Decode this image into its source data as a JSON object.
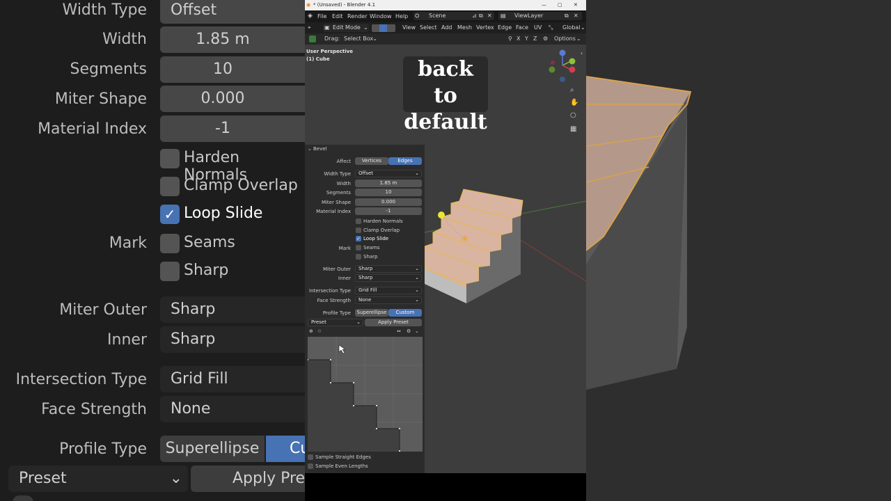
{
  "background_left": {
    "rows": [
      {
        "label": "Width Type",
        "value": "Offset"
      },
      {
        "label": "Width",
        "value": "1.85 m"
      },
      {
        "label": "Segments",
        "value": "10"
      },
      {
        "label": "Miter Shape",
        "value": "0.000"
      },
      {
        "label": "Material Index",
        "value": "-1"
      }
    ],
    "checks": [
      "Harden Normals",
      "Clamp Overlap",
      "Loop Slide"
    ],
    "mark_label": "Mark",
    "mark_checks": [
      "Seams",
      "Sharp"
    ],
    "rows2": [
      {
        "label": "Miter Outer",
        "value": "Sharp"
      },
      {
        "label": "Inner",
        "value": "Sharp"
      },
      {
        "label": "Intersection Type",
        "value": "Grid Fill"
      },
      {
        "label": "Face Strength",
        "value": "None"
      }
    ],
    "profile_label": "Profile Type",
    "profile_options": [
      "Superellipse",
      "Cu"
    ],
    "preset": "Preset",
    "apply_preset": "Apply Pres"
  },
  "window": {
    "title": "* (Unsaved) - Blender 4.1",
    "menus": [
      "File",
      "Edit",
      "Render",
      "Window",
      "Help"
    ],
    "scene": "Scene",
    "view_layer": "ViewLayer",
    "mode": "Edit Mode",
    "header_menus": [
      "View",
      "Select",
      "Add",
      "Mesh",
      "Vertex",
      "Edge",
      "Face",
      "UV"
    ],
    "orientation": "Global",
    "drag_label": "Drag:",
    "drag_value": "Select Box",
    "xyz": [
      "X",
      "Y",
      "Z"
    ],
    "options": "Options"
  },
  "viewport": {
    "perspective": "User Perspective",
    "object": "(1) Cube",
    "caption_line1": "back to",
    "caption_line2": "default"
  },
  "bevel_panel": {
    "title": "Bevel",
    "affect_label": "Affect",
    "affect_options": [
      "Vertices",
      "Edges"
    ],
    "width_type_label": "Width Type",
    "width_type": "Offset",
    "width_label": "Width",
    "width": "1.85 m",
    "segments_label": "Segments",
    "segments": "10",
    "miter_shape_label": "Miter Shape",
    "miter_shape": "0.000",
    "material_index_label": "Material Index",
    "material_index": "-1",
    "harden_normals": "Harden Normals",
    "clamp_overlap": "Clamp Overlap",
    "loop_slide": "Loop Slide",
    "mark_label": "Mark",
    "seams": "Seams",
    "sharp": "Sharp",
    "miter_outer_label": "Miter Outer",
    "miter_outer": "Sharp",
    "inner_label": "Inner",
    "inner": "Sharp",
    "intersection_type_label": "Intersection Type",
    "intersection_type": "Grid Fill",
    "face_strength_label": "Face Strength",
    "face_strength": "None",
    "profile_type_label": "Profile Type",
    "profile_options": [
      "Superellipse",
      "Custom"
    ],
    "preset": "Preset",
    "apply_preset": "Apply Preset",
    "sample_straight": "Sample Straight Edges",
    "sample_even": "Sample Even Lengths"
  },
  "colors": {
    "accent": "#4772b3",
    "selected_face": "#d9b4a0",
    "edge_highlight": "#f0c04a"
  }
}
